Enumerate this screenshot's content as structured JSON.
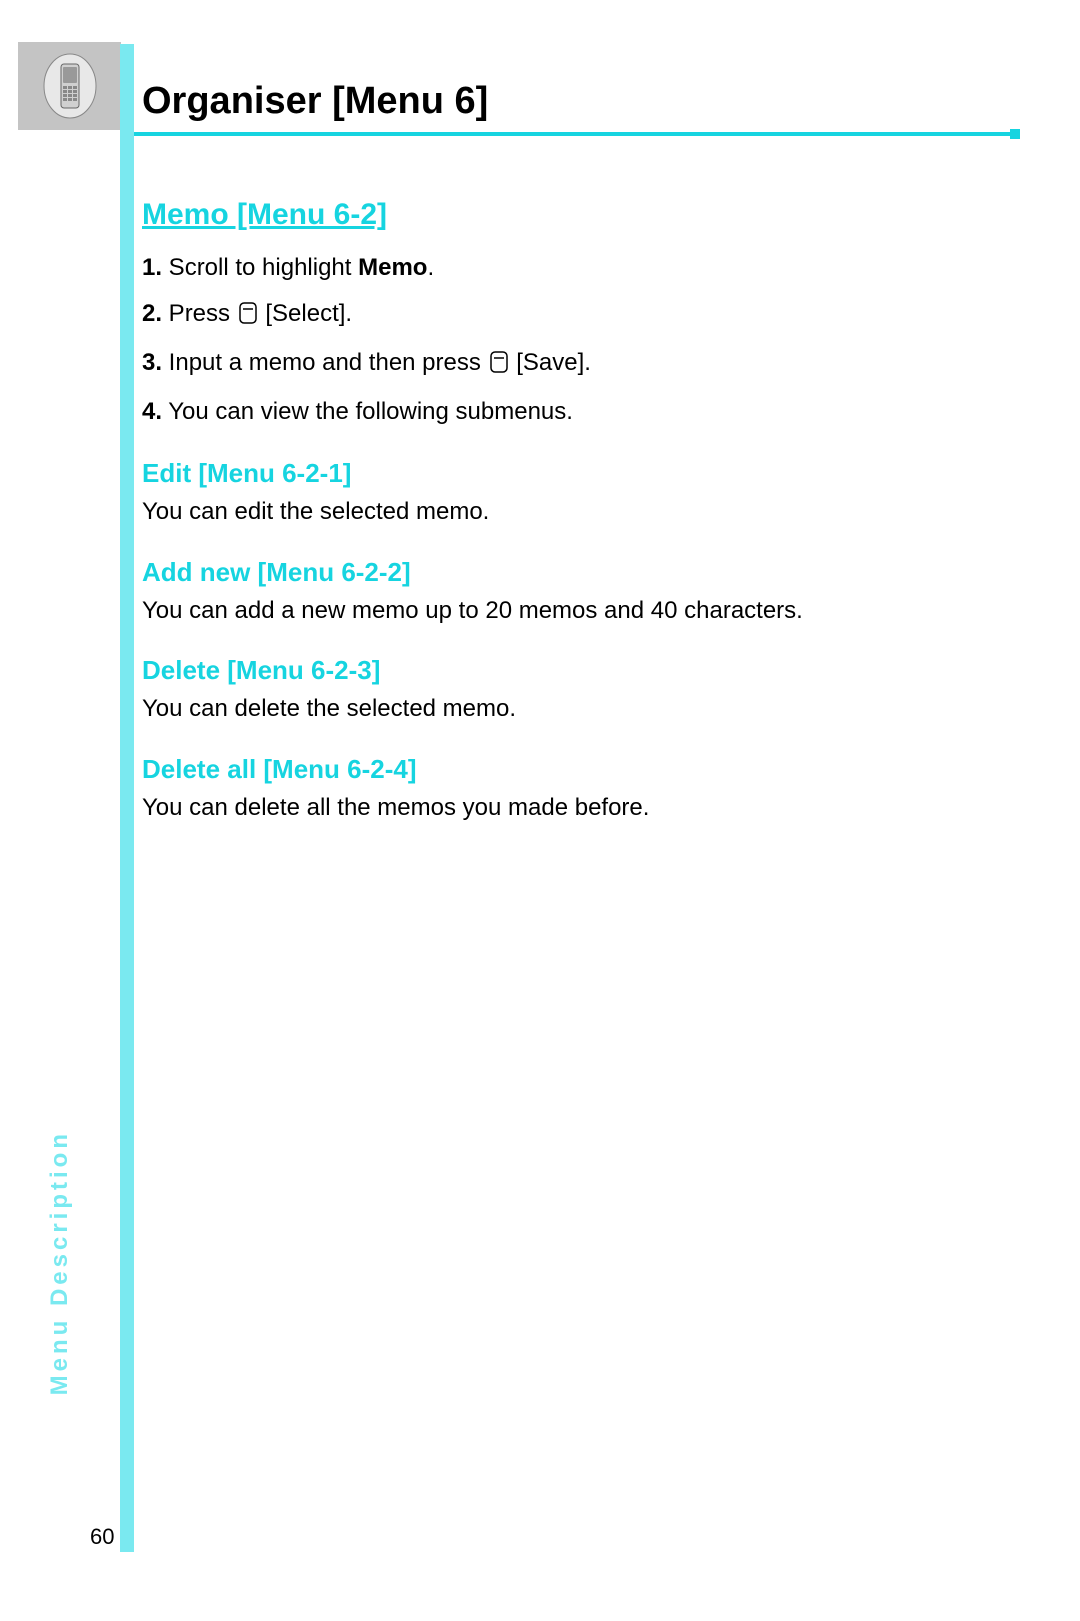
{
  "chapter_title": "Organiser [Menu 6]",
  "section": {
    "title": "Memo [Menu 6-2]",
    "steps": [
      {
        "num": "1.",
        "pre": " Scroll to highlight ",
        "bold": "Memo",
        "post": "."
      },
      {
        "num": "2.",
        "pre": " Press ",
        "button": true,
        "post_button": " [Select]."
      },
      {
        "num": "3.",
        "pre": " Input a memo and then press ",
        "button": true,
        "post_button": " [Save]."
      },
      {
        "num": "4.",
        "pre": " You can view the following submenus."
      }
    ],
    "subs": [
      {
        "title": "Edit [Menu 6-2-1]",
        "body": "You can edit the selected memo."
      },
      {
        "title": "Add new [Menu 6-2-2]",
        "body": "You can add a new memo up to 20 memos and 40 characters."
      },
      {
        "title": "Delete [Menu 6-2-3]",
        "body": "You can delete the selected memo."
      },
      {
        "title": "Delete all [Menu 6-2-4]",
        "body": "You can delete all the memos you made before."
      }
    ]
  },
  "vertical_label": "Menu Description",
  "page_number": "60"
}
